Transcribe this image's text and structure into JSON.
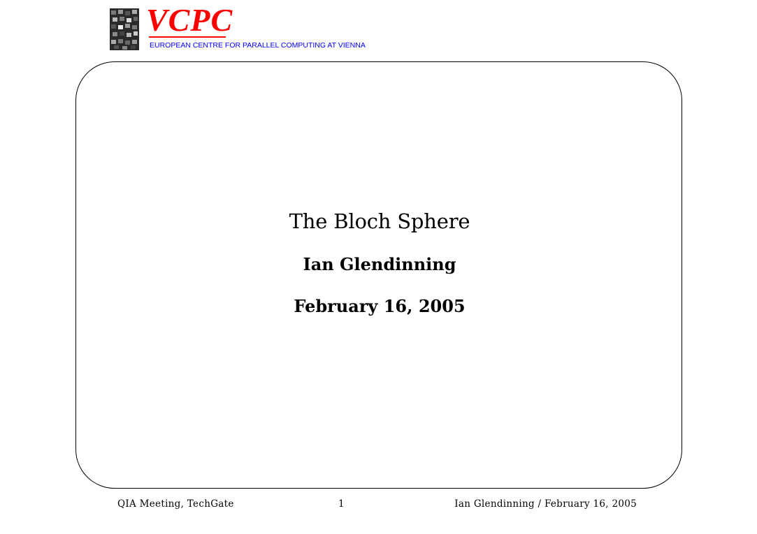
{
  "logo": {
    "title": "VCPC",
    "subtitle": "EUROPEAN CENTRE FOR PARALLEL COMPUTING AT VIENNA",
    "title_color": "#ff0000",
    "subtitle_color": "#0000ff"
  },
  "slide": {
    "title": "The Bloch Sphere",
    "author": "Ian Glendinning",
    "date": "February 16, 2005"
  },
  "footer": {
    "left": "QIA Meeting, TechGate",
    "page_number": "1",
    "right": "Ian Glendinning / February 16, 2005"
  }
}
